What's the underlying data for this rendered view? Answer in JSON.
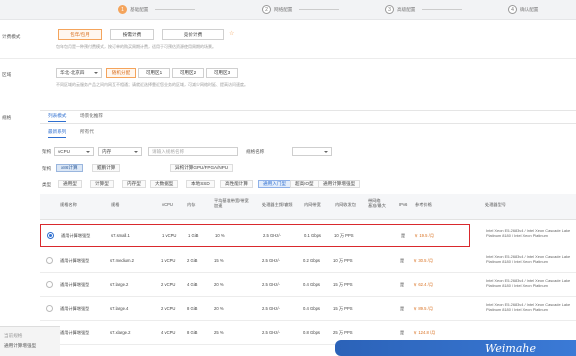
{
  "stepbar": {
    "steps": [
      {
        "num": "1",
        "label": "基础配置"
      },
      {
        "num": "2",
        "label": "网络配置"
      },
      {
        "num": "3",
        "label": "高级配置"
      },
      {
        "num": "4",
        "label": "确认配置"
      }
    ]
  },
  "billing": {
    "label": "计费模式",
    "options": [
      "包年/包月",
      "按需计费",
      "竞价计费"
    ],
    "selected": "包年/包月",
    "hint": "包年包月是一种预付费模式，按订单的购买周期计费，适用于可预估资源使用周期的场景。"
  },
  "region": {
    "label": "区域",
    "value": "华北-北京四",
    "zones": [
      "随机分配",
      "可用区1",
      "可用区2",
      "可用区3"
    ],
    "hint": "不同区域的云服务产品之间内网互不相通；请就近选择靠近您业务的区域，可减少网络时延、提高访问速度。"
  },
  "spec": {
    "label": "规格",
    "tabs": [
      "列表模式",
      "场景化推荐"
    ],
    "subtabs": [
      "最新系列",
      "所有代"
    ],
    "filter_label": "架构",
    "filter_placeholder": "vCPU",
    "filter_placeholder2": "内存",
    "filter_name_label": "规格名称",
    "filter_name_placeholder": "请输入规格名称",
    "arch_label": "架构",
    "arch_options": [
      "x86计算",
      "鲲鹏计算",
      "异构计算GPU/FPGA/NPU"
    ],
    "type_label": "类型",
    "types": [
      "通用型",
      "计算型",
      "内存型",
      "大数据型",
      "本地SSD",
      "高性能计算",
      "通用入门型",
      "超高IO型",
      "通用计算增强型"
    ],
    "active_type": "通用入门型"
  },
  "table": {
    "headers": [
      "规格名称",
      "规格",
      "vCPU",
      "内存",
      "基准/最大带宽",
      "CPU",
      "内网收发包",
      "IPv6",
      "参考价格",
      "规格描述"
    ],
    "header_lines": {
      "col0": "规格名称",
      "col1": "规格",
      "col2": "vCPU",
      "col3": "内存",
      "col4a": "平均基准带宽/带宽",
      "col4b": "加速",
      "col5": "处理器主频/睿频",
      "col6": "内网带宽",
      "col7": "内网收发包",
      "col8a": "带网络",
      "col8b": "基准/最大",
      "col9": "IPv6",
      "col10": "参考价格",
      "col11": "处理器型号"
    },
    "rows": [
      {
        "name": "通用计算增强型",
        "flavor": "s7.small.1",
        "vcpu": "1 vCPU",
        "mem": "1 GiB",
        "bw": "10 %",
        "freq": "2.5 GHz/-",
        "net": "0.1 Gbps",
        "pps": "10 万 PPS",
        "ipv6": "是",
        "price": "￥ 19.5 /月",
        "desc": "Intel Xeon E5-2683v4 / Intel Xeon Cascade Lake Platinum 8180 / Intel Xeon Platinum",
        "selected": true
      },
      {
        "name": "通用计算增强型",
        "flavor": "s7.medium.2",
        "vcpu": "1 vCPU",
        "mem": "2 GiB",
        "bw": "15 %",
        "freq": "2.5 GHz/-",
        "net": "0.2 Gbps",
        "pps": "10 万 PPS",
        "ipv6": "是",
        "price": "￥ 30.5 /月",
        "desc": "Intel Xeon E5-2683v4 / Intel Xeon Cascade Lake Platinum 8180 / Intel Xeon Platinum",
        "selected": false
      },
      {
        "name": "通用计算增强型",
        "flavor": "s7.large.2",
        "vcpu": "2 vCPU",
        "mem": "4 GiB",
        "bw": "20 %",
        "freq": "2.5 GHz/-",
        "net": "0.4 Gbps",
        "pps": "15 万 PPS",
        "ipv6": "是",
        "price": "￥ 62.4 /月",
        "desc": "Intel Xeon E5-2683v4 / Intel Xeon Cascade Lake Platinum 8180 / Intel Xeon Platinum",
        "selected": false
      },
      {
        "name": "通用计算增强型",
        "flavor": "s7.large.4",
        "vcpu": "2 vCPU",
        "mem": "8 GiB",
        "bw": "20 %",
        "freq": "2.5 GHz/-",
        "net": "0.4 Gbps",
        "pps": "15 万 PPS",
        "ipv6": "是",
        "price": "￥ 89.5 /月",
        "desc": "Intel Xeon E5-2683v4 / Intel Xeon Cascade Lake Platinum 8180 / Intel Xeon Platinum",
        "selected": false
      },
      {
        "name": "通用计算增强型",
        "flavor": "s7.xlarge.2",
        "vcpu": "4 vCPU",
        "mem": "8 GiB",
        "bw": "25 %",
        "freq": "2.5 GHz/-",
        "net": "0.8 Gbps",
        "pps": "25 万 PPS",
        "ipv6": "是",
        "price": "￥ 124.8 /月",
        "desc": "Intel Xeon E5-2683v4 / Intel Xeon Cascade Lake Platinum 8180 / Intel Xeon Platinum",
        "selected": false
      }
    ]
  },
  "footer": {
    "label": "当前规格",
    "value": "通用计算增强型"
  },
  "watermark": "Weimahe"
}
